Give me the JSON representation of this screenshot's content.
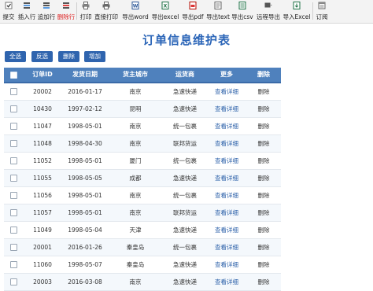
{
  "toolbar": {
    "items": [
      {
        "label": "提交",
        "icon": "submit-icon",
        "color": "#222"
      },
      {
        "label": "插入行",
        "icon": "insert-row-icon",
        "color": "#222"
      },
      {
        "label": "追加行",
        "icon": "append-row-icon",
        "color": "#222"
      },
      {
        "label": "删除行",
        "icon": "delete-row-icon",
        "color": "#dd2222"
      },
      {
        "label": "打印",
        "icon": "print-icon",
        "color": "#222"
      },
      {
        "label": "直接打印",
        "icon": "direct-print-icon",
        "color": "#222"
      },
      {
        "label": "导出word",
        "icon": "word-icon",
        "color": "#222"
      },
      {
        "label": "导出excel",
        "icon": "excel-icon",
        "color": "#222"
      },
      {
        "label": "导出pdf",
        "icon": "pdf-icon",
        "color": "#222"
      },
      {
        "label": "导出text",
        "icon": "text-icon",
        "color": "#222"
      },
      {
        "label": "导出csv",
        "icon": "csv-icon",
        "color": "#222"
      },
      {
        "label": "远程导出",
        "icon": "remote-export-icon",
        "color": "#222"
      },
      {
        "label": "导入Excel",
        "icon": "import-excel-icon",
        "color": "#222"
      },
      {
        "label": "订阅",
        "icon": "subscribe-icon",
        "color": "#222"
      }
    ]
  },
  "page": {
    "title": "订单信息维护表"
  },
  "actions": {
    "select_all": "全选",
    "invert": "反选",
    "delete": "删除",
    "add": "增加"
  },
  "table": {
    "columns": [
      "",
      "订单ID",
      "发货日期",
      "货主城市",
      "运货商",
      "更多",
      "删除"
    ],
    "rows": [
      {
        "id": "20002",
        "date": "2016-01-17",
        "city": "南京",
        "shipper": "急速快递",
        "more": "查看详细",
        "del": "删除"
      },
      {
        "id": "10430",
        "date": "1997-02-12",
        "city": "昆明",
        "shipper": "急速快递",
        "more": "查看详细",
        "del": "删除"
      },
      {
        "id": "11047",
        "date": "1998-05-01",
        "city": "南京",
        "shipper": "统一包裹",
        "more": "查看详细",
        "del": "删除"
      },
      {
        "id": "11048",
        "date": "1998-04-30",
        "city": "南京",
        "shipper": "联邦货运",
        "more": "查看详细",
        "del": "删除"
      },
      {
        "id": "11052",
        "date": "1998-05-01",
        "city": "厦门",
        "shipper": "统一包裹",
        "more": "查看详细",
        "del": "删除"
      },
      {
        "id": "11055",
        "date": "1998-05-05",
        "city": "成都",
        "shipper": "急速快递",
        "more": "查看详细",
        "del": "删除"
      },
      {
        "id": "11056",
        "date": "1998-05-01",
        "city": "南京",
        "shipper": "统一包裹",
        "more": "查看详细",
        "del": "删除"
      },
      {
        "id": "11057",
        "date": "1998-05-01",
        "city": "南京",
        "shipper": "联邦货运",
        "more": "查看详细",
        "del": "删除"
      },
      {
        "id": "11049",
        "date": "1998-05-04",
        "city": "天津",
        "shipper": "急速快递",
        "more": "查看详细",
        "del": "删除"
      },
      {
        "id": "20001",
        "date": "2016-01-26",
        "city": "秦皇岛",
        "shipper": "统一包裹",
        "more": "查看详细",
        "del": "删除"
      },
      {
        "id": "11060",
        "date": "1998-05-07",
        "city": "秦皇岛",
        "shipper": "急速快递",
        "more": "查看详细",
        "del": "删除"
      },
      {
        "id": "20003",
        "date": "2016-03-08",
        "city": "南京",
        "shipper": "急速快递",
        "more": "查看详细",
        "del": "删除"
      }
    ]
  }
}
